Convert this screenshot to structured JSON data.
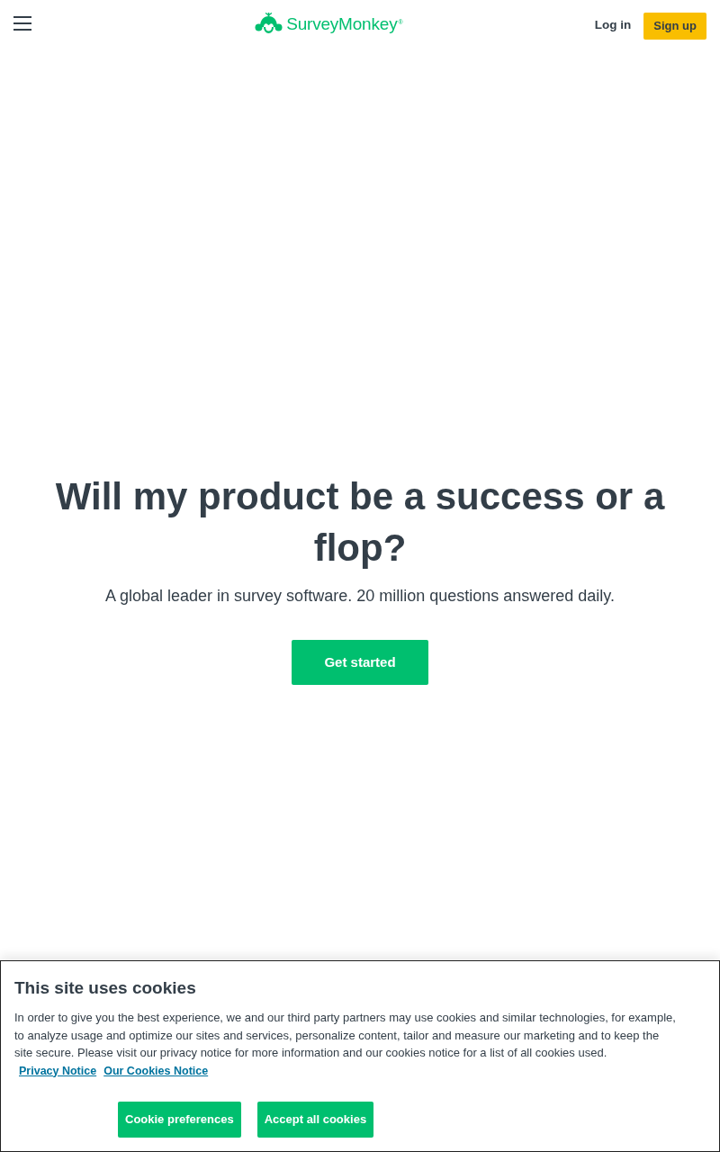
{
  "header": {
    "logo": {
      "text": "SurveyMonkey",
      "mark": "®"
    },
    "login": "Log in",
    "signup": "Sign up"
  },
  "hero": {
    "title": "Will my product be a success or a flop?",
    "subtitle": "A global leader in survey software. 20 million questions answered daily.",
    "cta": "Get started"
  },
  "cookie_banner": {
    "title": "This site uses cookies",
    "text": "In order to give you the best experience, we and our third party partners may use cookies and similar technologies, for example, to analyze usage and optimize our sites and services, personalize content, tailor and measure our marketing and to keep the site secure. Please visit our privacy notice for more information and our cookies notice for a list of all cookies used.",
    "links": [
      "Privacy Notice",
      "Our Cookies Notice"
    ],
    "buttons": [
      "Cookie preferences",
      "Accept all cookies"
    ]
  }
}
